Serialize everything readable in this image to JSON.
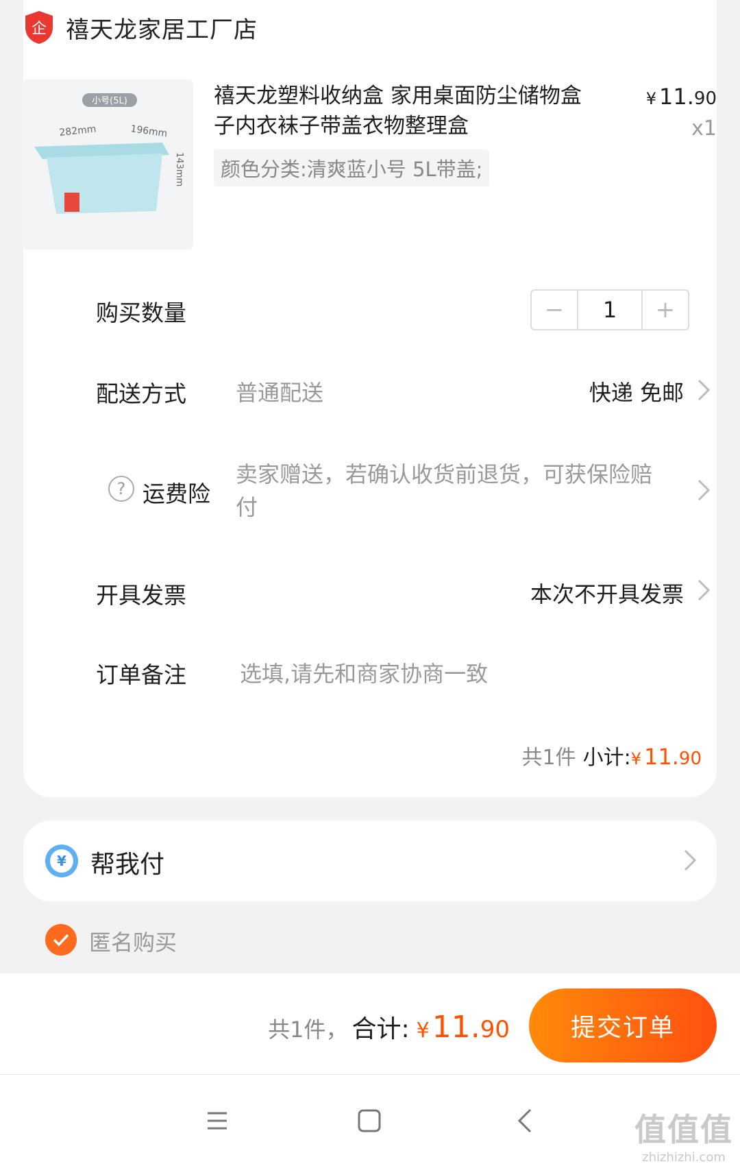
{
  "store": {
    "badge_glyph": "企",
    "name": "禧天龙家居工厂店"
  },
  "product": {
    "image_label": "小号(5L)",
    "image_dims": [
      "282mm",
      "196mm",
      "143mm"
    ],
    "title": "禧天龙塑料收纳盒 家用桌面防尘储物盒子内衣袜子带盖衣物整理盒",
    "price_yen": "¥",
    "price_int": "11.",
    "price_dec": "90",
    "quantity": "x1",
    "sku": "颜色分类:清爽蓝小号 5L带盖;"
  },
  "rows": {
    "buy_qty": {
      "label": "购买数量",
      "minus": "−",
      "value": "1",
      "plus": "+"
    },
    "delivery": {
      "label": "配送方式",
      "sub": "普通配送",
      "value": "快递 免邮"
    },
    "insurance": {
      "label": "运费险",
      "help_glyph": "?",
      "sub": "卖家赠送，若确认收货前退货，可获保险赔付"
    },
    "invoice": {
      "label": "开具发票",
      "value": "本次不开具发票"
    },
    "note": {
      "label": "订单备注",
      "placeholder": "选填,请先和商家协商一致"
    }
  },
  "subtotal": {
    "count": "共1件",
    "label": "小计:",
    "yen": "¥",
    "int": "11.",
    "dec": "90"
  },
  "help_pay": {
    "icon_glyph": "¥",
    "label": "帮我付"
  },
  "anonymous": {
    "label": "匿名购买",
    "checked": true
  },
  "footer": {
    "count": "共1件，",
    "label": "合计:",
    "yen": "¥",
    "int": "11.",
    "dec": "90",
    "submit": "提交订单"
  },
  "watermark": {
    "big": "值值值",
    "small": "zhizhizhi.com"
  },
  "colors": {
    "accent": "#ff5000",
    "button_start": "#ff8a0a",
    "button_end": "#ff5010",
    "shield": "#e8382f"
  },
  "icons": [
    "shield-icon",
    "chevron-right-icon",
    "help-circle-icon",
    "yen-circle-icon",
    "checkmark-icon",
    "menu-icon",
    "home-icon",
    "back-icon"
  ]
}
